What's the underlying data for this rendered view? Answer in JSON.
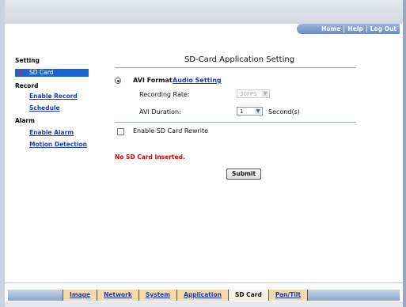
{
  "header": {
    "links": [
      "Home",
      "Help",
      "Log Out"
    ]
  },
  "sidebar": {
    "setting_header": "Setting",
    "selected_item": "SD Card",
    "record_header": "Record",
    "record_items": [
      "Enable Record",
      "Schedule"
    ],
    "alarm_header": "Alarm",
    "alarm_items": [
      "Enable Alarm",
      "Motion Detection"
    ]
  },
  "main": {
    "title": "SD-Card Application Setting",
    "avi_format_label": "AVI Format",
    "audio_setting_link": "Audio Setting",
    "recording_rate_label": "Recording Rate:",
    "recording_rate_value": "30FPS",
    "avi_duration_label": "AVI Duration:",
    "avi_duration_value": "1",
    "duration_unit": "Second(s)",
    "rewrite_label": "Enable SD Card Rewrite",
    "warning": "No SD Card Inserted.",
    "submit_label": "Submit"
  },
  "bottom_tabs": [
    "Image",
    "Network",
    "System",
    "Application",
    "SD Card",
    "Pan/Tilt"
  ],
  "active_tab": "SD Card",
  "colors": {
    "link": "#1a3cbb",
    "selected_bg": "#1a66cc",
    "warning": "#cc0000",
    "tab_bg": "#f5d9a8"
  }
}
